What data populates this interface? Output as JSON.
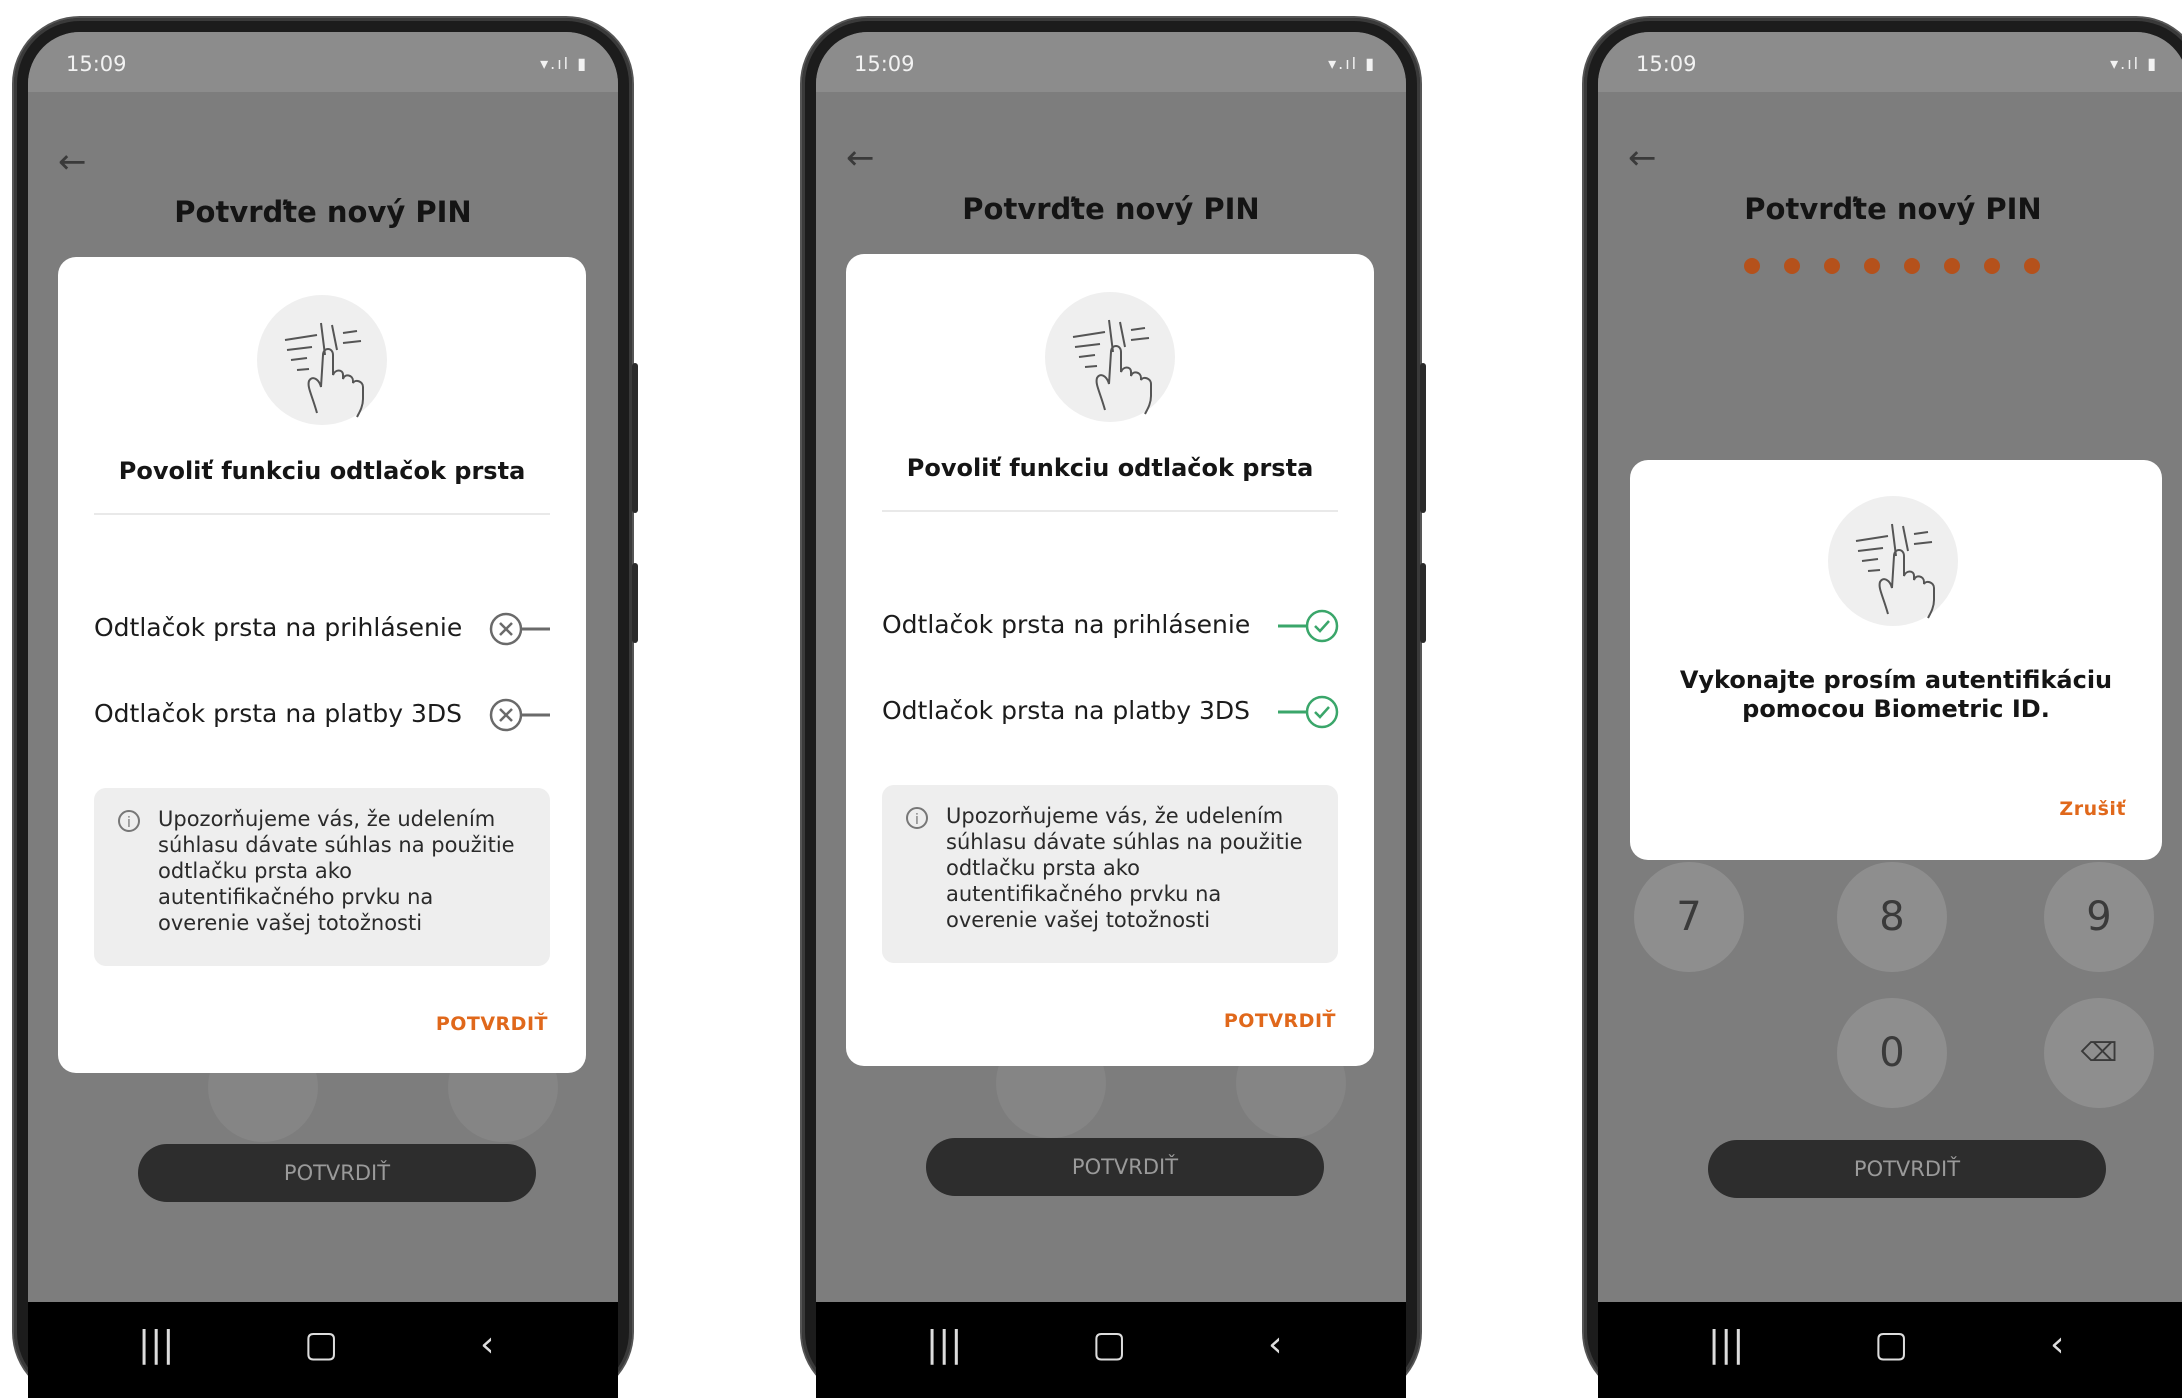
{
  "phones": [
    {
      "status_time": "15:09",
      "title": "Potvrďte nový PIN",
      "card_title": "Povoliť funkciu odtlačok prsta",
      "options": [
        "Odtlačok prsta na prihlásenie",
        "Odtlačok prsta na platby 3DS"
      ],
      "toggle_state": "off",
      "info_text": [
        "Upozorňujeme vás, že udelením",
        "súhlasu dávate súhlas na použitie",
        "odtlačku prsta ako",
        "autentifikačného prvku na",
        "overenie vašej totožnosti"
      ],
      "card_action": "POTVRDIŤ",
      "confirm_button": "POTVRDIŤ"
    },
    {
      "status_time": "15:09",
      "title": "Potvrďte nový PIN",
      "card_title": "Povoliť funkciu odtlačok prsta",
      "options": [
        "Odtlačok prsta na prihlásenie",
        "Odtlačok prsta na platby 3DS"
      ],
      "toggle_state": "on",
      "info_text": [
        "Upozorňujeme vás, že udelením",
        "súhlasu dávate súhlas na použitie",
        "odtlačku prsta ako",
        "autentifikačného prvku na",
        "overenie vašej totožnosti"
      ],
      "card_action": "POTVRDIŤ",
      "confirm_button": "POTVRDIŤ"
    },
    {
      "status_time": "15:09",
      "title": "Potvrďte nový PIN",
      "pin_length": 8,
      "dialog_text": [
        "Vykonajte prosím autentifikáciu",
        "pomocou Biometric ID."
      ],
      "dialog_action": "Zrušiť",
      "keys": [
        "7",
        "8",
        "9",
        "0"
      ],
      "confirm_button": "POTVRDIŤ"
    }
  ],
  "colors": {
    "accent": "#e0681b",
    "pin_dot": "#b5511b",
    "toggle_on": "#3aa66a",
    "toggle_off": "#6a6a6a",
    "overlay": "#7d7d7d"
  },
  "icons": {
    "back": "arrow-left-icon",
    "fingerprint": "fingerprint-touch-icon",
    "info": "info-circle-icon",
    "backspace": "backspace-icon",
    "nav_recent": "recent-apps-icon",
    "nav_home": "home-icon",
    "nav_back": "chevron-left-icon"
  }
}
